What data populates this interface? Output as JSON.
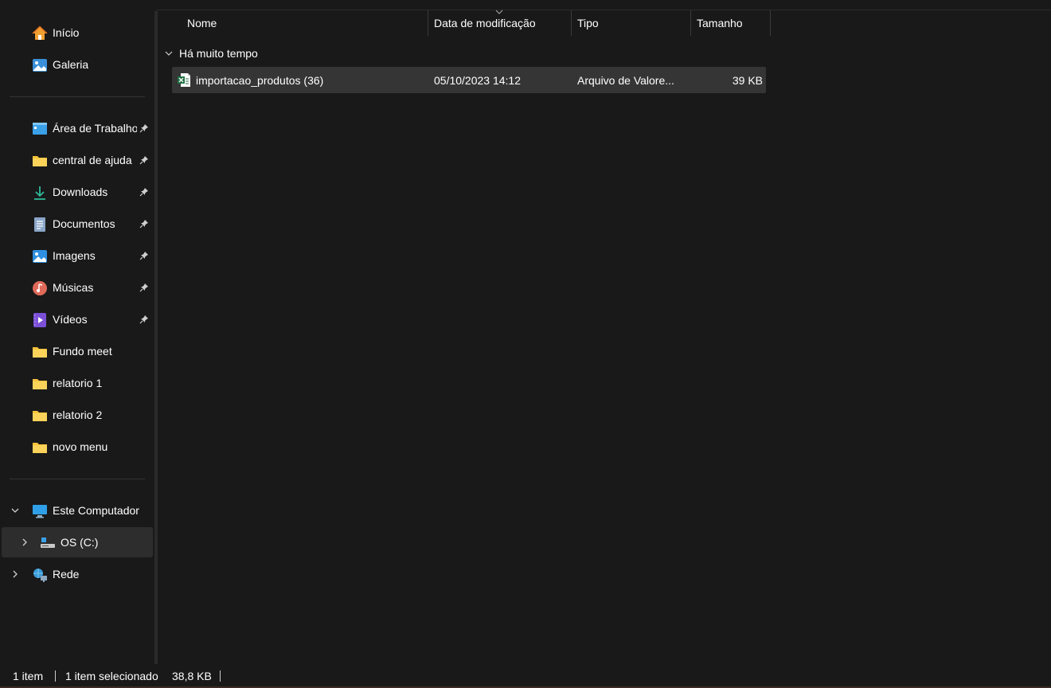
{
  "sidebar": {
    "quick": [
      {
        "label": "Início",
        "icon": "home-icon"
      },
      {
        "label": "Galeria",
        "icon": "gallery-icon"
      }
    ],
    "pinned": [
      {
        "label": "Área de Trabalho",
        "icon": "desktop-icon",
        "pinned": true
      },
      {
        "label": "central de ajuda",
        "icon": "folder-icon",
        "pinned": true
      },
      {
        "label": "Downloads",
        "icon": "download-icon",
        "pinned": true
      },
      {
        "label": "Documentos",
        "icon": "document-icon",
        "pinned": true
      },
      {
        "label": "Imagens",
        "icon": "pictures-icon",
        "pinned": true
      },
      {
        "label": "Músicas",
        "icon": "music-icon",
        "pinned": true
      },
      {
        "label": "Vídeos",
        "icon": "videos-icon",
        "pinned": true
      },
      {
        "label": "Fundo meet",
        "icon": "folder-icon",
        "pinned": false
      },
      {
        "label": "relatorio 1",
        "icon": "folder-icon",
        "pinned": false
      },
      {
        "label": "relatorio 2",
        "icon": "folder-icon",
        "pinned": false
      },
      {
        "label": "novo menu",
        "icon": "folder-icon",
        "pinned": false
      }
    ],
    "this_pc": {
      "label": "Este Computador",
      "icon": "computer-icon",
      "expanded": true
    },
    "drive": {
      "label": "OS (C:)",
      "icon": "drive-icon",
      "selected": true
    },
    "network": {
      "label": "Rede",
      "icon": "network-icon"
    }
  },
  "columns": {
    "name": "Nome",
    "modified": "Data de modificação",
    "type": "Tipo",
    "size": "Tamanho"
  },
  "group": {
    "label": "Há muito tempo"
  },
  "files": [
    {
      "name": "importacao_produtos (36)",
      "modified": "05/10/2023 14:12",
      "type": "Arquivo de Valore...",
      "size": "39 KB",
      "icon": "excel-csv-icon"
    }
  ],
  "status": {
    "count": "1 item",
    "selected": "1 item selecionado",
    "selected_size": "38,8 KB"
  },
  "colors": {
    "background": "#191919",
    "selected_row": "#353535",
    "folder": "#f8c33b",
    "excel_green": "#1d6f42"
  }
}
